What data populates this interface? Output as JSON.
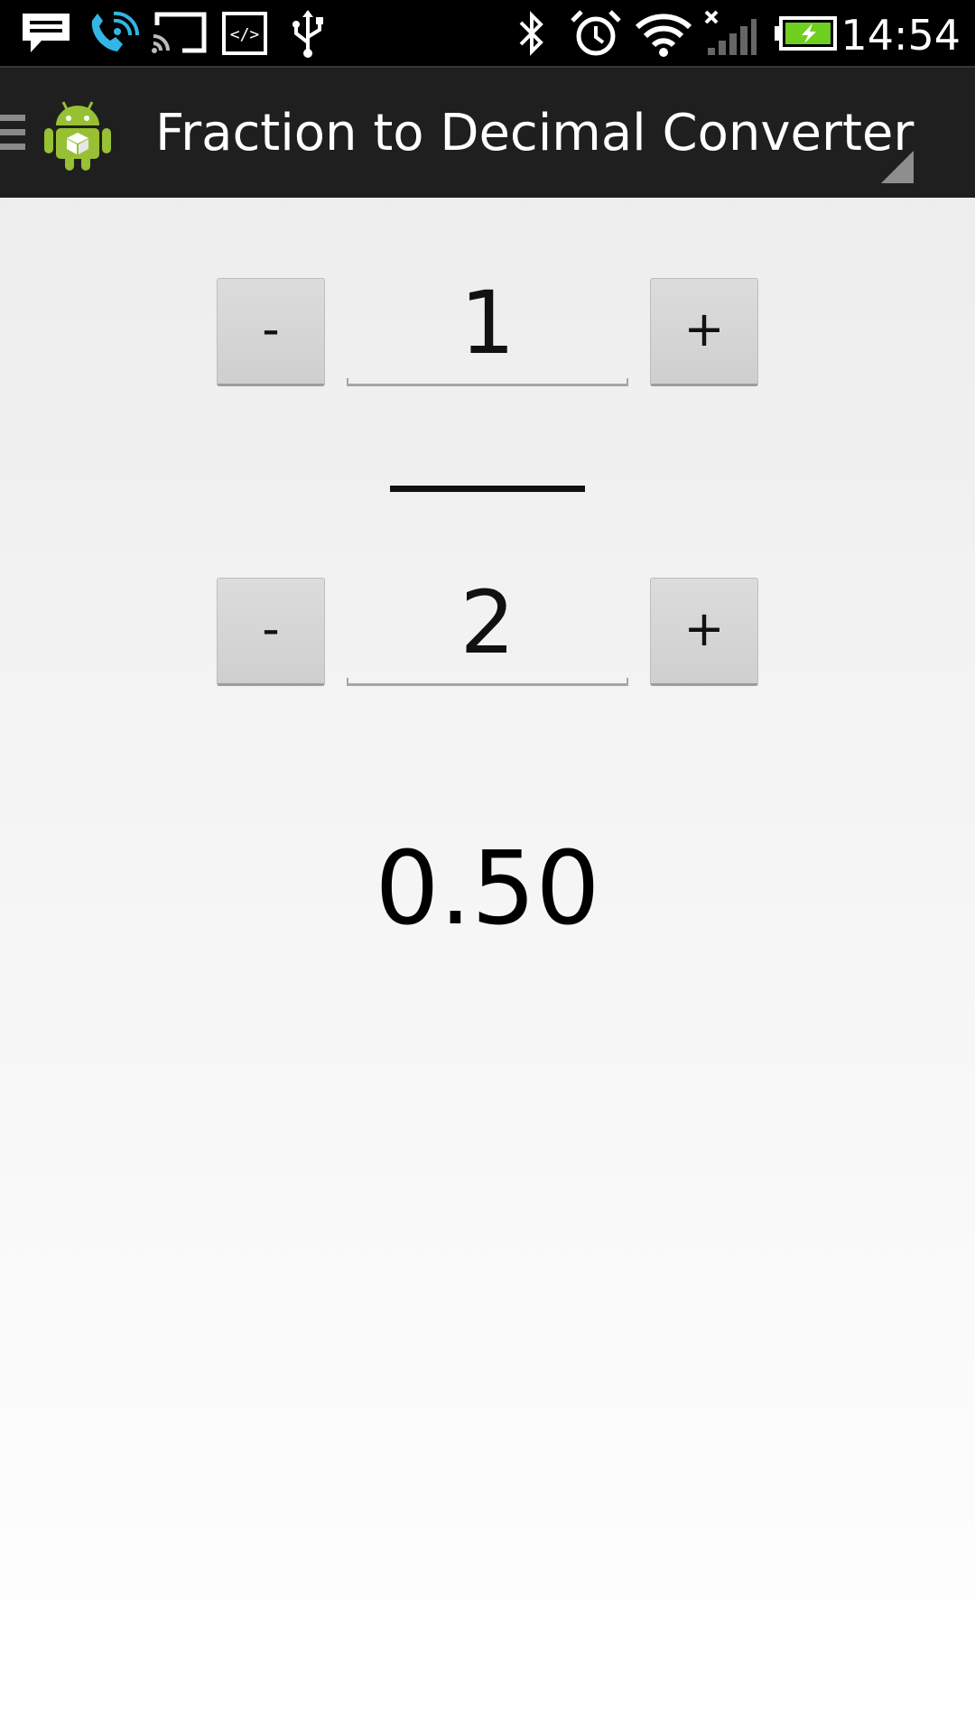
{
  "status_bar": {
    "clock": "14:54",
    "left_icons": [
      "message-icon",
      "wifi-calling-icon",
      "cast-icon",
      "developer-code-icon",
      "usb-icon"
    ],
    "right_icons": [
      "bluetooth-icon",
      "alarm-icon",
      "wifi-icon",
      "signal-no-service-icon",
      "battery-charging-icon"
    ],
    "battery_color": "#6fcf1f"
  },
  "action_bar": {
    "title": "Fraction to Decimal Converter",
    "app_icon": "android-app-icon",
    "android_green": "#98c034"
  },
  "numerator": {
    "decrement_label": "-",
    "value": "1",
    "increment_label": "+"
  },
  "denominator": {
    "decrement_label": "-",
    "value": "2",
    "increment_label": "+"
  },
  "result": {
    "value": "0.50"
  }
}
